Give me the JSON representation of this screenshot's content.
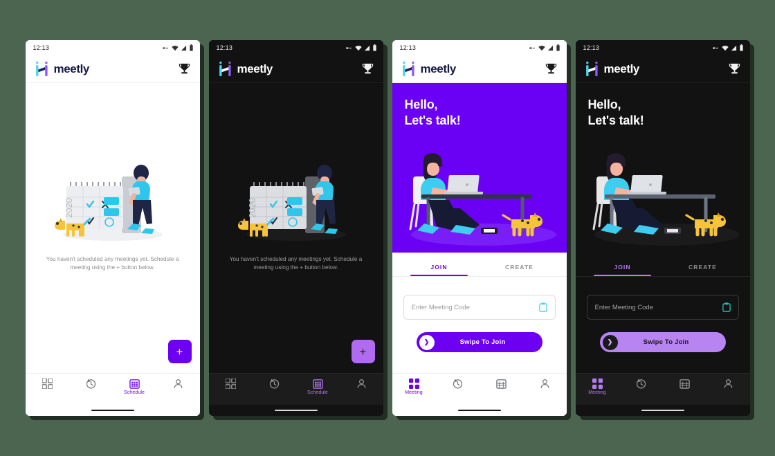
{
  "app": {
    "name": "meetly",
    "status_time": "12:13",
    "accent_purple": "#6d00f0",
    "accent_purple_light": "#b47cf2",
    "accent_cyan": "#45d3f0",
    "hero_bg": "#6a00f4",
    "canvas_bg": "#4c6551"
  },
  "screens": [
    {
      "id": "schedule-light",
      "theme": "light",
      "empty_text": "You haven't scheduled any meetings yet. Schedule a meeting using the + button below.",
      "fab_label": "+",
      "nav_active_label": "Schedule"
    },
    {
      "id": "schedule-dark",
      "theme": "dark",
      "empty_text": "You haven't scheduled any meetings yet. Schedule a meeting using the + button below.",
      "fab_label": "+",
      "nav_active_label": "Schedule"
    },
    {
      "id": "meeting-light",
      "theme": "light",
      "hero_line1": "Hello,",
      "hero_line2": "Let's talk!",
      "tab_join": "JOIN",
      "tab_create": "CREATE",
      "code_placeholder": "Enter Meeting Code",
      "swipe_label": "Swipe To Join",
      "nav_active_label": "Meeting"
    },
    {
      "id": "meeting-dark",
      "theme": "dark",
      "hero_line1": "Hello,",
      "hero_line2": "Let's talk!",
      "tab_join": "JOIN",
      "tab_create": "CREATE",
      "code_placeholder": "Enter Meeting Code",
      "swipe_label": "Swipe To Join",
      "nav_active_label": "Meeting"
    }
  ],
  "icons": {
    "trophy": "trophy-icon",
    "wifi": "wifi-icon",
    "signal": "signal-icon",
    "battery": "battery-icon",
    "link": "link-icon",
    "clipboard": "clipboard-icon",
    "grid": "grid-icon",
    "history": "history-icon",
    "calendar": "calendar-icon",
    "person": "person-icon",
    "chevron_right": "chevron-right-icon"
  }
}
